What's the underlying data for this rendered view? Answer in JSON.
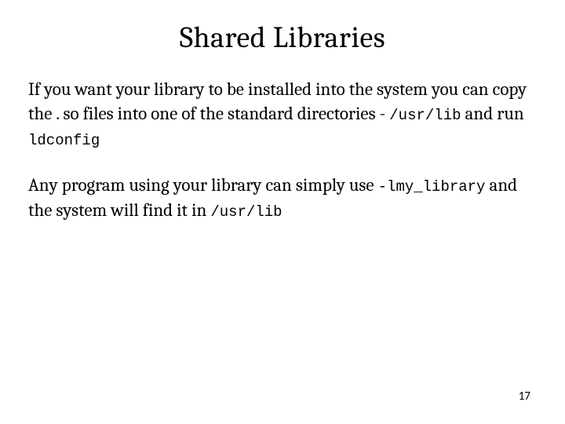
{
  "title": "Shared Libraries",
  "para1": {
    "t1": "If you want your library to be installed into the system you can copy the . so files into one of the standard directories - ",
    "c1": "/usr/lib",
    "t2": " and run ",
    "c2": "ldconfig"
  },
  "para2": {
    "t1": "Any program using your library can simply use ",
    "c1": "-lmy_library",
    "t2": " and the system will find it in ",
    "c2": "/usr/lib"
  },
  "page_number": "17"
}
